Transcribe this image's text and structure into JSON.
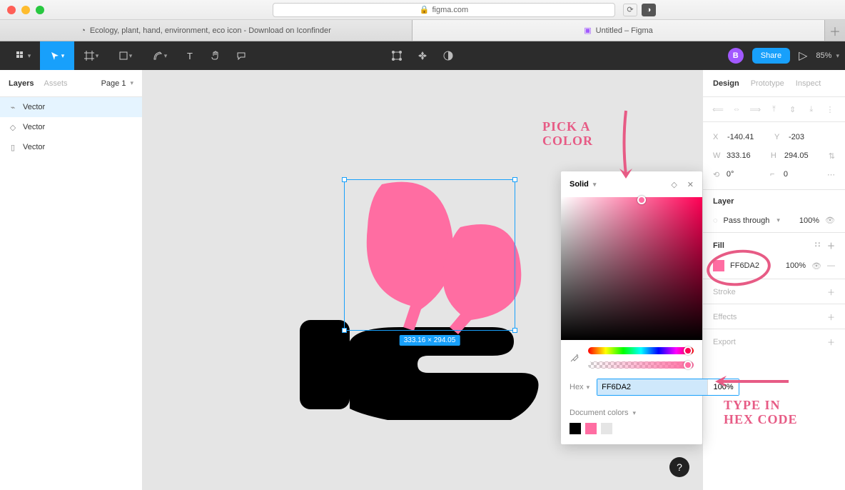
{
  "browser": {
    "url": "figma.com",
    "tabs": [
      {
        "title": "Ecology, plant, hand, environment, eco icon - Download on Iconfinder"
      },
      {
        "title": "Untitled – Figma"
      }
    ]
  },
  "toolbar": {
    "avatar_initial": "B",
    "share_label": "Share",
    "zoom": "85%"
  },
  "left_panel": {
    "tabs": {
      "layers": "Layers",
      "assets": "Assets"
    },
    "page_label": "Page 1",
    "layers": [
      "Vector",
      "Vector",
      "Vector"
    ]
  },
  "right_panel": {
    "tabs": {
      "design": "Design",
      "prototype": "Prototype",
      "inspect": "Inspect"
    },
    "x": "-140.41",
    "y": "-203",
    "w": "333.16",
    "h": "294.05",
    "rotation": "0°",
    "corner": "0",
    "layer_section": "Layer",
    "blend_mode": "Pass through",
    "blend_opacity": "100%",
    "fill_section": "Fill",
    "fill_hex": "FF6DA2",
    "fill_opacity": "100%",
    "stroke_section": "Stroke",
    "effects_section": "Effects",
    "export_section": "Export"
  },
  "color_picker": {
    "mode": "Solid",
    "hex_label": "Hex",
    "hex_value": "FF6DA2",
    "hex_opacity": "100%",
    "doc_colors_label": "Document colors",
    "doc_swatches": [
      "#000000",
      "#ff6da2",
      "#e5e5e5"
    ]
  },
  "selection": {
    "dims": "333.16 × 294.05"
  },
  "annotations": {
    "pick": "pick a\ncolor",
    "type": "type in\nhex code"
  }
}
